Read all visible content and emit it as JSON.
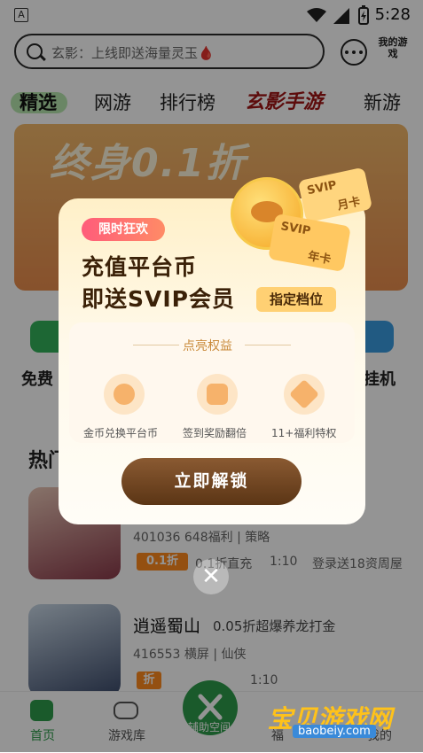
{
  "status_bar": {
    "time": "5:28",
    "app_badge": "A"
  },
  "search": {
    "placeholder": "玄影：上线即送海量灵玉🩸"
  },
  "header": {
    "my_games_label": "我的游戏"
  },
  "tabs": [
    {
      "label": "精选",
      "active": true
    },
    {
      "label": "网游"
    },
    {
      "label": "排行榜"
    },
    {
      "label": "玄影手游"
    },
    {
      "label": "新游"
    }
  ],
  "banner": {
    "text": "终身0.1折"
  },
  "categories": {
    "left": "免费",
    "right": "挂机"
  },
  "section_title": "热门",
  "games": [
    {
      "meta": "401036  648福利 | 策略",
      "badge": "0.1折",
      "price": "0.1折直充",
      "time": "1:10",
      "promo": "登录送18资周屋"
    },
    {
      "name": "逍遥蜀山",
      "subtitle": "0.05折超爆养龙打金",
      "meta": "416553  横屏 | 仙侠",
      "badge": "折",
      "time": "1:10"
    }
  ],
  "bottom_nav": [
    {
      "label": "首页",
      "active": true
    },
    {
      "label": "游戏库"
    },
    {
      "label": "辅助空间"
    },
    {
      "label": "福"
    },
    {
      "label": "我的"
    }
  ],
  "modal": {
    "tag": "限时狂欢",
    "title_line1": "充值平台币",
    "title_line2": "即送SVIP会员",
    "tier_badge": "指定档位",
    "card1": "SVIP",
    "card1_sub": "月卡",
    "card2": "SVIP",
    "card2_sub": "年卡",
    "benefits_title": "点亮权益",
    "benefits": [
      {
        "label": "金币兑换平台币",
        "icon": "coin-exchange-icon"
      },
      {
        "label": "签到奖励翻倍",
        "icon": "calendar-check-icon"
      },
      {
        "label": "11+福利特权",
        "icon": "privilege-badge-icon"
      }
    ],
    "unlock_label": "立即解锁",
    "close_glyph": "✕"
  },
  "watermark": {
    "main": "宝贝游戏网",
    "sub": "baobeiy.com"
  },
  "colors": {
    "accent_green": "#2e9c4a",
    "unlock_brown": "#6b4220",
    "tag_pink": "#ff5c7a"
  }
}
